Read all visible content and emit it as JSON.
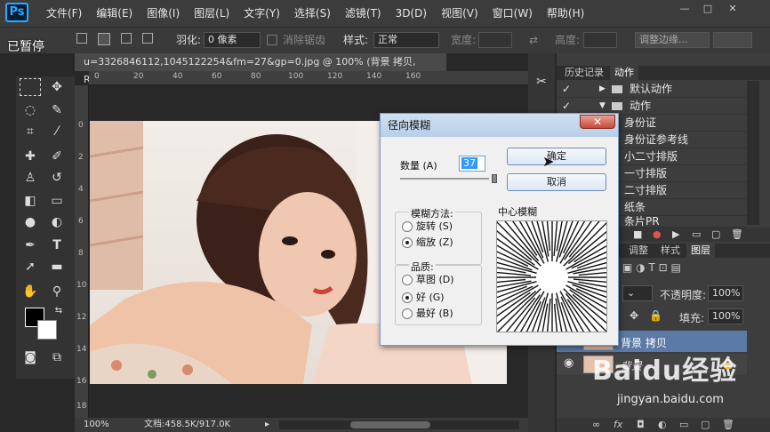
{
  "app": {
    "logo": "Ps"
  },
  "menu": [
    "文件(F)",
    "编辑(E)",
    "图像(I)",
    "图层(L)",
    "文字(Y)",
    "选择(S)",
    "滤镜(T)",
    "3D(D)",
    "视图(V)",
    "窗口(W)",
    "帮助(H)"
  ],
  "window_controls": {
    "minimize": "—",
    "restore": "□",
    "close": "✕"
  },
  "recording_badge": "已暂停",
  "options": {
    "feather_label": "羽化:",
    "feather_value": "0 像素",
    "antialias_label": "消除锯齿",
    "style_label": "样式:",
    "style_value": "正常",
    "width_label": "宽度:",
    "height_label": "高度:",
    "refine_button": "调整边缘..."
  },
  "document": {
    "tab_title": "u=3326846112,1045122254&fm=27&gp=0.jpg @ 100% (背景 拷贝, RGB/8#) *",
    "tab_close": "×",
    "ruler_h": [
      "0",
      "20",
      "40",
      "60",
      "80",
      "100",
      "120",
      "140",
      "160"
    ],
    "ruler_v": [
      "0",
      "2",
      "4",
      "6",
      "8",
      "10",
      "12",
      "14",
      "16",
      "18"
    ]
  },
  "status": {
    "zoom": "100%",
    "doc_info": "文档:458.5K/917.0K"
  },
  "dialog": {
    "title": "径向模糊",
    "close": "✕",
    "amount_label": "数量 (A)",
    "amount_value": "37",
    "ok_button": "确定",
    "cancel_button": "取消",
    "method_group": "模糊方法:",
    "method_spin": "旋转 (S)",
    "method_zoom": "缩放 (Z)",
    "quality_group": "品质:",
    "quality_draft": "草图 (D)",
    "quality_good": "好 (G)",
    "quality_best": "最好 (B)",
    "center_label": "中心模糊",
    "amount_slider_fraction": 0.37,
    "selected_method": "缩放 (Z)",
    "selected_quality": "好 (G)"
  },
  "panels": {
    "tab_history": "历史记录",
    "tab_actions": "动作",
    "actions": [
      "默认动作",
      "动作",
      "身份证",
      "身份证参考线",
      "小二寸排版",
      "一寸排版",
      "二寸排版",
      "纸条",
      "条片PR"
    ],
    "layer_tabs": [
      "调整",
      "样式",
      "图层"
    ],
    "opacity_label": "不透明度:",
    "opacity_value": "100%",
    "fill_label": "填充:",
    "fill_value": "100%",
    "layers": [
      "背景 拷贝",
      "背景"
    ]
  },
  "watermark": {
    "brand": "Baidu经验",
    "url": "jingyan.baidu.com"
  },
  "colors": {
    "accent": "#31a8ff",
    "cursor_highlight": "#f5ef00",
    "dialog_border": "#7a9cc6"
  }
}
